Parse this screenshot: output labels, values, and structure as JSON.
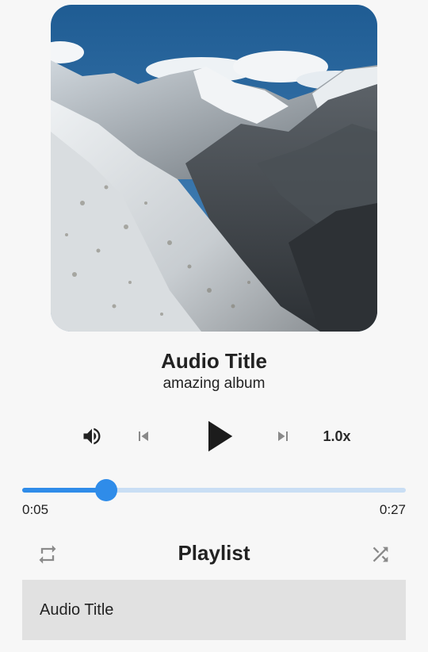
{
  "now_playing": {
    "title": "Audio Title",
    "album": "amazing album",
    "artwork": "snowy-mountain-valley"
  },
  "controls": {
    "volume_icon": "volume-up-icon",
    "previous_icon": "skip-previous-icon",
    "play_icon": "play-icon",
    "next_icon": "skip-next-icon",
    "speed_label": "1.0x"
  },
  "progress": {
    "position": "0:05",
    "duration": "0:27",
    "fraction": 0.22
  },
  "playlist": {
    "heading": "Playlist",
    "repeat_icon": "repeat-icon",
    "shuffle_icon": "shuffle-icon",
    "items": [
      {
        "label": "Audio Title",
        "selected": true
      }
    ]
  },
  "colors": {
    "accent": "#2f8ce9",
    "track": "#c9def4",
    "background": "#f7f7f7",
    "item_background": "#e1e1e1"
  }
}
